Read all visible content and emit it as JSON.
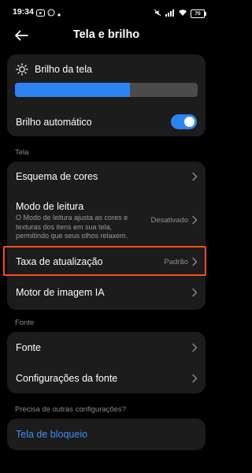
{
  "status_bar": {
    "time": "19:34",
    "battery": "70",
    "icons": [
      "youtube-icon",
      "whatsapp-icon",
      "dot-icon",
      "mute-icon",
      "signal-icon",
      "wifi-icon",
      "battery-icon"
    ]
  },
  "header": {
    "title": "Tela e brilho",
    "back_icon": "back-arrow-icon"
  },
  "brightness": {
    "label": "Brilho da tela",
    "icon": "sun-icon",
    "level_fraction": 0.63,
    "auto_label": "Brilho automático",
    "auto_enabled": true
  },
  "section_tela": {
    "label": "Tela",
    "items": [
      {
        "label": "Esquema de cores"
      },
      {
        "label": "Modo de leitura",
        "description": "O Modo de leitura ajusta as cores e texturas dos itens em sua tela, permitindo que seus olhos relaxem.",
        "value": "Desativado"
      },
      {
        "label": "Taxa de atualização",
        "value": "Padrão"
      },
      {
        "label": "Motor de imagem IA"
      }
    ]
  },
  "section_fonte": {
    "label": "Fonte",
    "items": [
      {
        "label": "Fonte"
      },
      {
        "label": "Configurações da fonte"
      }
    ]
  },
  "section_more": {
    "label": "Precisa de outras configurações?",
    "link": "Tela de bloqueio"
  },
  "colors": {
    "accent": "#2e83f2",
    "highlight": "#ff4a1c",
    "card": "#1c1c1c"
  }
}
